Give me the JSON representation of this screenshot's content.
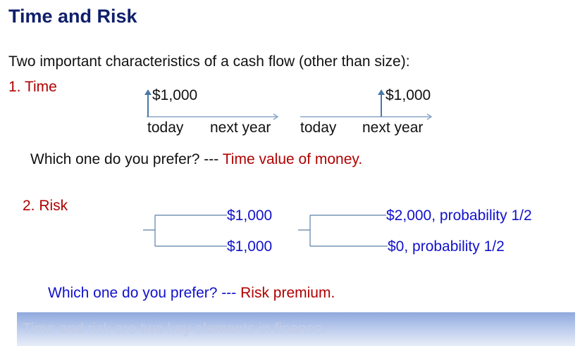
{
  "title": "Time and Risk",
  "intro": "Two important characteristics of a cash flow (other than size):",
  "time": {
    "heading": "1.  Time",
    "option_a": {
      "amount": "$1,000",
      "today": "today",
      "next_year": "next year"
    },
    "option_b": {
      "amount": "$1,000",
      "today": "today",
      "next_year": "next year"
    },
    "question": "Which one do you prefer? --- ",
    "answer": "Time value of money."
  },
  "risk": {
    "heading": "2.  Risk",
    "option_a": {
      "top": "$1,000",
      "bottom": "$1,000"
    },
    "option_b": {
      "top": "$2,000, probability 1/2",
      "bottom": "$0, probability 1/2"
    },
    "question": "Which one do you prefer? --- ",
    "answer": "Risk premium."
  },
  "banner": "Time and risk are two key elements in finance.",
  "colors": {
    "title": "#0f1f6b",
    "accent_red": "#b00000",
    "accent_blue": "#1111cc",
    "line": "#5b7fa8"
  }
}
